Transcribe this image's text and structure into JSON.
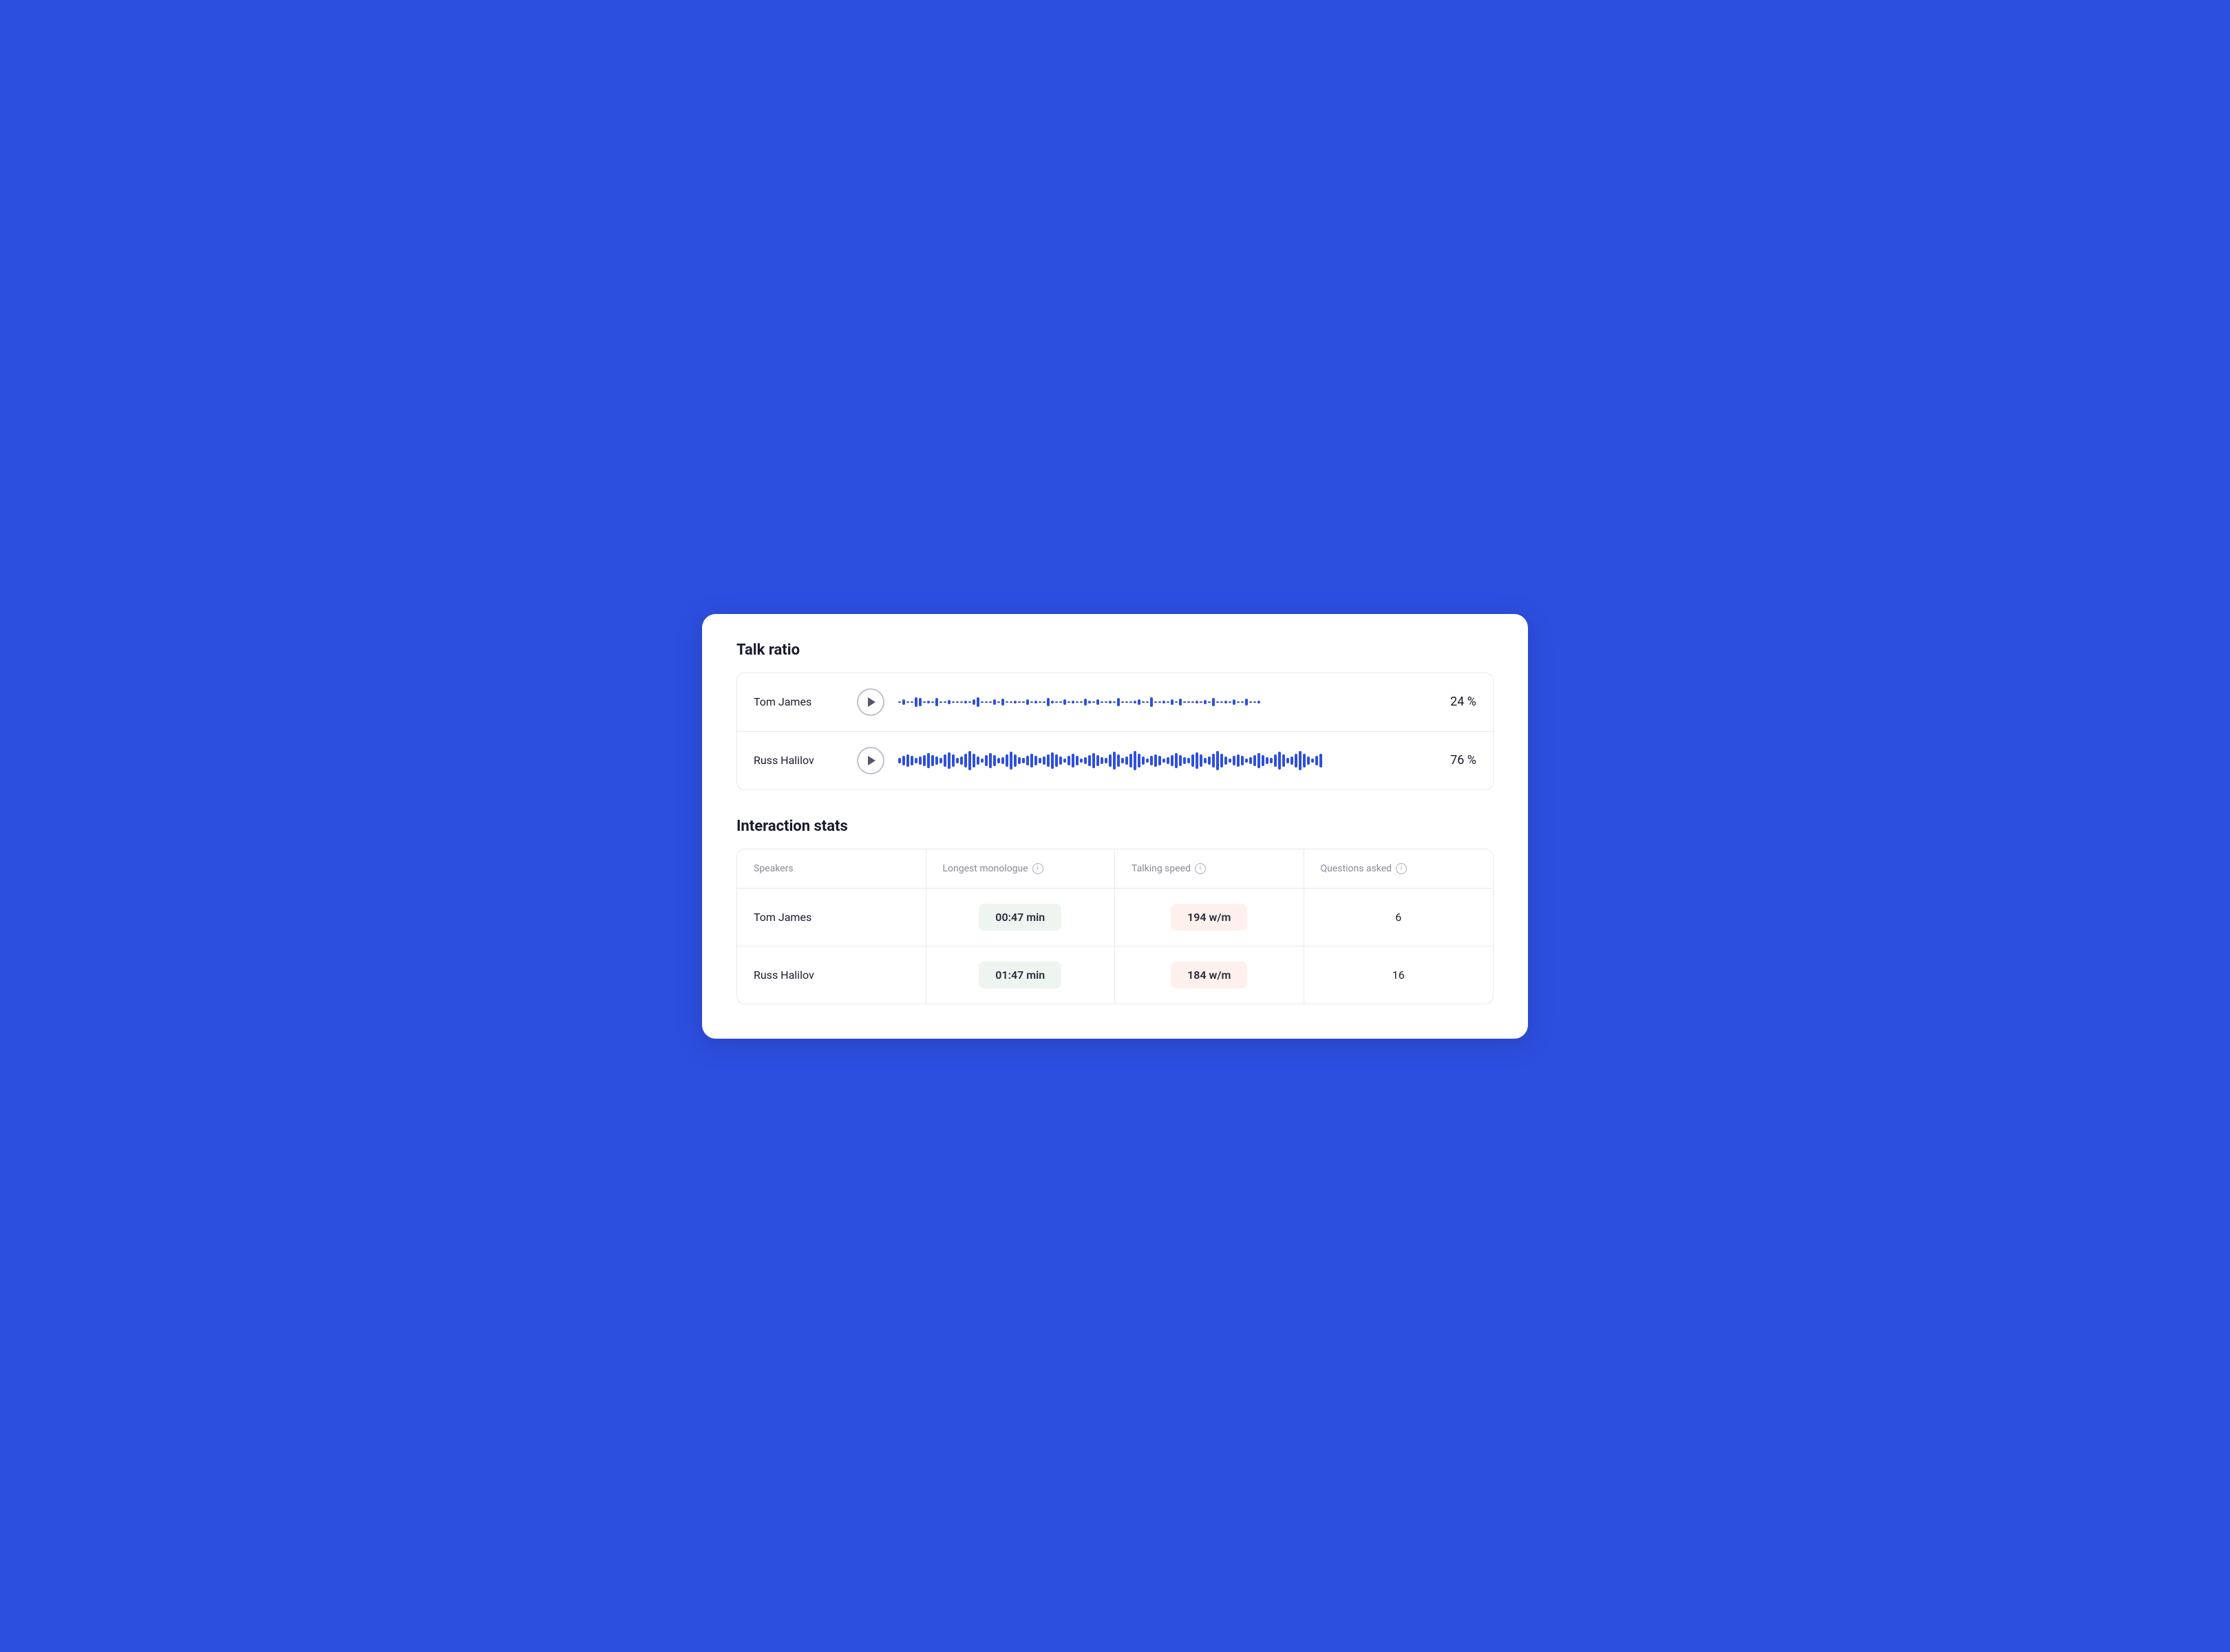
{
  "talk_ratio": {
    "section_title": "Talk ratio",
    "speakers": [
      {
        "name": "Tom James",
        "percentage": "24 %",
        "waveform_density": "low"
      },
      {
        "name": "Russ Halilov",
        "percentage": "76 %",
        "waveform_density": "high"
      }
    ]
  },
  "interaction_stats": {
    "section_title": "Interaction stats",
    "headers": {
      "speakers": "Speakers",
      "longest_monologue": "Longest monologue",
      "talking_speed": "Talking speed",
      "questions_asked": "Questions asked"
    },
    "rows": [
      {
        "speaker": "Tom James",
        "longest_monologue": "00:47 min",
        "talking_speed": "194 w/m",
        "questions_asked": "6"
      },
      {
        "speaker": "Russ Halilov",
        "longest_monologue": "01:47 min",
        "talking_speed": "184 w/m",
        "questions_asked": "16"
      }
    ]
  }
}
